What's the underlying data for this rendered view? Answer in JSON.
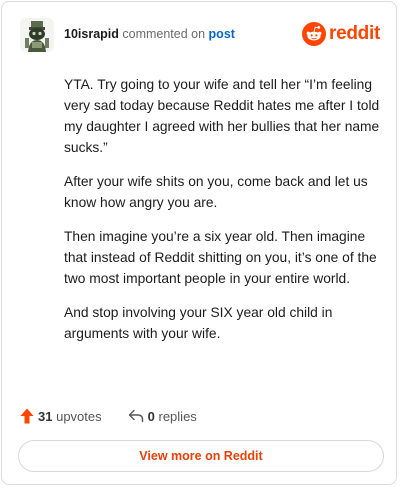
{
  "comment": {
    "username": "10israpid",
    "action_text": "commented on",
    "post_link": "post",
    "paragraphs": [
      "YTA. Try going to your wife and tell her “I’m feeling very sad today because Reddit hates me after I told my daughter I agreed with her bullies that her name sucks.”",
      "After your wife shits on you, come back and let us know how angry you are.",
      "Then imagine you’re a six year old. Then imagine that instead of Reddit shitting on you, it’s one of the two most important people in your entire world.",
      "And stop involving your SIX year old child in arguments with your wife."
    ]
  },
  "brand": {
    "name": "reddit",
    "logo_icon": "reddit-alien-icon",
    "accent": "#ff4500"
  },
  "stats": {
    "upvote_icon": "upvote-arrow-icon",
    "upvotes_count": "31",
    "upvotes_label": "upvotes",
    "reply_icon": "reply-icon",
    "replies_count": "0",
    "replies_label": "replies"
  },
  "cta": {
    "label": "View more on Reddit"
  }
}
